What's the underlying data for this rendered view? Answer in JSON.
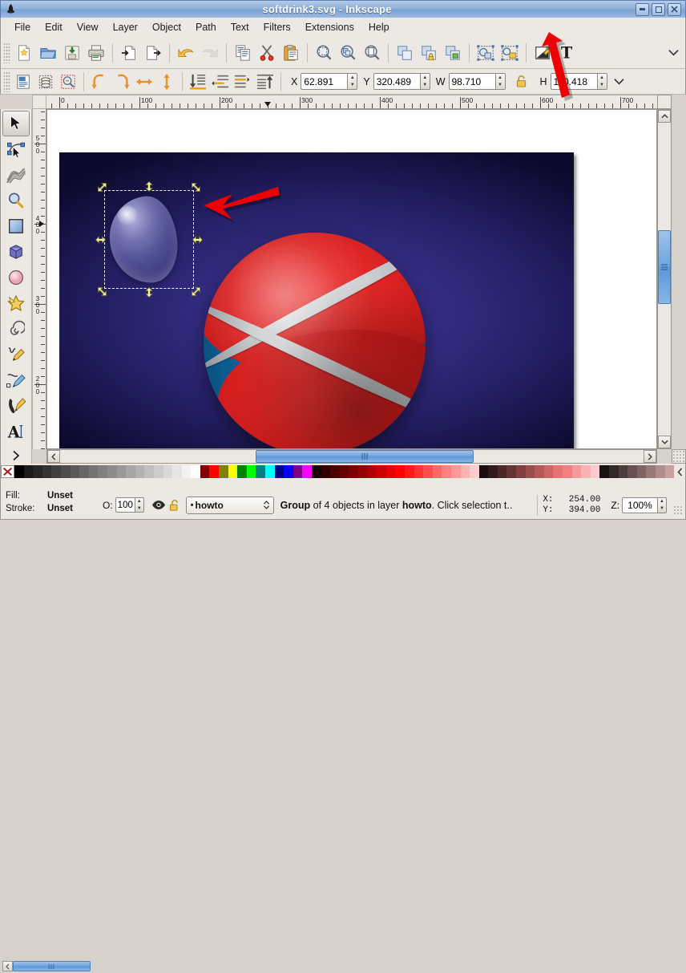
{
  "window": {
    "title": "softdrink3.svg - Inkscape",
    "app_icon": "inkscape-logo-icon",
    "buttons": {
      "minimize": "minimize-icon",
      "maximize": "maximize-icon",
      "close": "close-icon"
    }
  },
  "menubar": {
    "items": [
      {
        "label": "File"
      },
      {
        "label": "Edit"
      },
      {
        "label": "View"
      },
      {
        "label": "Layer"
      },
      {
        "label": "Object"
      },
      {
        "label": "Path"
      },
      {
        "label": "Text"
      },
      {
        "label": "Filters"
      },
      {
        "label": "Extensions"
      },
      {
        "label": "Help"
      }
    ]
  },
  "command_toolbar": {
    "items": [
      {
        "icon": "new-document-icon",
        "group": 1
      },
      {
        "icon": "open-folder-icon",
        "group": 1
      },
      {
        "icon": "save-document-icon",
        "group": 1
      },
      {
        "icon": "print-icon",
        "group": 1
      },
      {
        "icon": "import-icon",
        "group": 2
      },
      {
        "icon": "export-icon",
        "group": 2
      },
      {
        "icon": "undo-icon",
        "group": 3
      },
      {
        "icon": "redo-icon",
        "group": 3,
        "disabled": true
      },
      {
        "icon": "copy-icon",
        "group": 4
      },
      {
        "icon": "cut-scissors-icon",
        "group": 4
      },
      {
        "icon": "paste-clipboard-icon",
        "group": 4
      },
      {
        "icon": "zoom-selection-icon",
        "group": 5
      },
      {
        "icon": "zoom-drawing-icon",
        "group": 5
      },
      {
        "icon": "zoom-page-icon",
        "group": 5
      },
      {
        "icon": "duplicate-icon",
        "group": 6
      },
      {
        "icon": "clone-icon",
        "group": 6
      },
      {
        "icon": "unlink-clone-icon",
        "group": 6
      },
      {
        "icon": "group-objects-icon",
        "group": 7
      },
      {
        "icon": "ungroup-objects-icon",
        "group": 7
      },
      {
        "icon": "fill-stroke-dialog-icon",
        "group": 8
      },
      {
        "icon": "text-properties-icon",
        "group": 8
      }
    ],
    "overflow": "chevron-down-icon"
  },
  "selector_toolbar": {
    "items": [
      {
        "icon": "select-all-icon",
        "group": 1
      },
      {
        "icon": "select-all-layers-icon",
        "group": 1
      },
      {
        "icon": "deselect-icon",
        "group": 1
      },
      {
        "icon": "rotate-ccw-90-icon",
        "group": 2
      },
      {
        "icon": "rotate-cw-90-icon",
        "group": 2
      },
      {
        "icon": "flip-horizontal-icon",
        "group": 2
      },
      {
        "icon": "flip-vertical-icon",
        "group": 2
      },
      {
        "icon": "lower-to-bottom-icon",
        "group": 3
      },
      {
        "icon": "lower-one-step-icon",
        "group": 3
      },
      {
        "icon": "raise-one-step-icon",
        "group": 3
      },
      {
        "icon": "raise-to-top-icon",
        "group": 3
      }
    ],
    "fields": [
      {
        "label": "X",
        "value": "62.891",
        "name": "x-field"
      },
      {
        "label": "Y",
        "value": "320.489",
        "name": "y-field"
      },
      {
        "label": "W",
        "value": "98.710",
        "name": "width-field"
      },
      {
        "label": "H",
        "value": "110.418",
        "name": "height-field"
      }
    ],
    "lock_icon": "lock-ratio-icon",
    "units_overflow": "chevron-down-icon"
  },
  "toolbox": {
    "tools": [
      {
        "name": "selector-tool",
        "icon": "arrow-cursor-icon",
        "active": true
      },
      {
        "name": "node-tool",
        "icon": "node-editor-icon",
        "active": false
      },
      {
        "name": "tweak-tool",
        "icon": "tweak-icon",
        "active": false
      },
      {
        "name": "zoom-tool",
        "icon": "magnifier-icon",
        "active": false
      },
      {
        "name": "rectangle-tool",
        "icon": "rectangle-icon",
        "active": false
      },
      {
        "name": "box3d-tool",
        "icon": "cube-3d-icon",
        "active": false
      },
      {
        "name": "ellipse-tool",
        "icon": "circle-icon",
        "active": false
      },
      {
        "name": "star-tool",
        "icon": "star-icon",
        "active": false
      },
      {
        "name": "spiral-tool",
        "icon": "spiral-icon",
        "active": false
      },
      {
        "name": "pencil-tool",
        "icon": "pencil-icon",
        "active": false
      },
      {
        "name": "bezier-tool",
        "icon": "bezier-pen-icon",
        "active": false
      },
      {
        "name": "calligraphy-tool",
        "icon": "calligraphy-pen-icon",
        "active": false
      },
      {
        "name": "text-tool",
        "icon": "text-a-icon",
        "active": false
      }
    ],
    "more": "chevron-right-icon"
  },
  "rulers": {
    "horizontal_labels": [
      "0",
      "100",
      "200",
      "300",
      "400",
      "500",
      "600",
      "700"
    ],
    "vertical_labels": [
      "500",
      "400",
      "300",
      "200"
    ],
    "unit": "1"
  },
  "canvas": {
    "document_background": "#2a2270",
    "selection": {
      "object_description": "Group of 4 objects",
      "handle_icon": "scale-handle-arrow-icon"
    },
    "annotations": [
      {
        "name": "canvas-arrow-annotation",
        "color": "#ee0000"
      },
      {
        "name": "toolbar-arrow-annotation",
        "color": "#ee0000"
      }
    ],
    "artwork": {
      "ball_red": "#dd2222",
      "ball_blue": "#0d5e94",
      "ball_band": "#d5d8db",
      "blob_fill": "#7878bc"
    }
  },
  "scrollbars": {
    "vertical": {
      "up": "scroll-up-icon",
      "down": "scroll-down-icon",
      "thumb": "scroll-thumb"
    },
    "horizontal": {
      "left": "scroll-left-icon",
      "right": "scroll-right-icon",
      "thumb": "scroll-thumb"
    }
  },
  "palette": {
    "none_swatch": "no-color-swatch",
    "colors": [
      "#000000",
      "#1a1a1a",
      "#262626",
      "#333333",
      "#404040",
      "#4d4d4d",
      "#595959",
      "#666666",
      "#737373",
      "#808080",
      "#8c8c8c",
      "#999999",
      "#a6a6a6",
      "#b3b3b3",
      "#bfbfbf",
      "#cccccc",
      "#d9d9d9",
      "#e6e6e6",
      "#f2f2f2",
      "#ffffff",
      "#800000",
      "#ff0000",
      "#808000",
      "#ffff00",
      "#008000",
      "#00ff00",
      "#008080",
      "#00ffff",
      "#000080",
      "#0000ff",
      "#800080",
      "#ff00ff",
      "#1a0000",
      "#330000",
      "#4d0000",
      "#660000",
      "#800000",
      "#990000",
      "#b30000",
      "#cc0000",
      "#e60000",
      "#ff0000",
      "#ff1a1a",
      "#ff3333",
      "#ff4d4d",
      "#ff6666",
      "#ff8080",
      "#ff9999",
      "#ffb3b3",
      "#ffcccc",
      "#1a0d0d",
      "#33191a",
      "#4d2626",
      "#663333",
      "#804040",
      "#994d4d",
      "#b35959",
      "#cc6666",
      "#e67373",
      "#f08080",
      "#f59999",
      "#fab3b3",
      "#fdcccc",
      "#1a1414",
      "#332828",
      "#4d3c3c",
      "#665050",
      "#806464",
      "#997878",
      "#b38c8c",
      "#c9a0a0"
    ],
    "more": "palette-more-icon"
  },
  "statusbar": {
    "fill_label": "Fill:",
    "fill_value": "Unset",
    "stroke_label": "Stroke:",
    "stroke_value": "Unset",
    "opacity_label": "O:",
    "opacity_value": "100",
    "visibility_icon": "eye-icon",
    "lock_icon": "unlocked-padlock-icon",
    "layer_indicator": "howto",
    "layer_dropdown_icon": "updown-chevron-icon",
    "message": "Group of 4 objects in layer howto. Click selection t..",
    "message_bold_1": "Group",
    "message_mid": " of 4 objects in layer ",
    "message_bold_2": "howto",
    "message_tail": ". Click selection t..",
    "x_label": "X:",
    "x_value": "254.00",
    "y_label": "Y:",
    "y_value": "394.00",
    "zoom_label": "Z:",
    "zoom_value": "100%"
  }
}
